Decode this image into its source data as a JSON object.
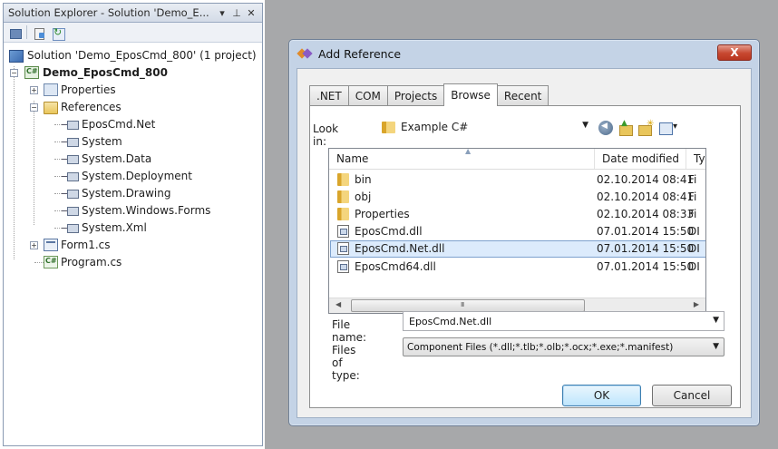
{
  "solution_explorer": {
    "title": "Solution Explorer - Solution 'Demo_E...",
    "pin_icon": "pin-icon",
    "dropdown_icon": "dropdown-icon",
    "close_icon": "close-icon",
    "tree": {
      "solution": "Solution 'Demo_EposCmd_800' (1 project)",
      "project": "Demo_EposCmd_800",
      "properties": "Properties",
      "references": "References",
      "reference_items": [
        "EposCmd.Net",
        "System",
        "System.Data",
        "System.Deployment",
        "System.Drawing",
        "System.Windows.Forms",
        "System.Xml"
      ],
      "form": "Form1.cs",
      "program": "Program.cs"
    }
  },
  "dialog": {
    "title": "Add Reference",
    "close_label": "X",
    "tabs": [
      ".NET",
      "COM",
      "Projects",
      "Browse",
      "Recent"
    ],
    "active_tab": "Browse",
    "look_in_label": "Look in:",
    "look_in_value": "Example C#",
    "columns": {
      "name": "Name",
      "date": "Date modified",
      "type": "Ty"
    },
    "files": [
      {
        "name": "bin",
        "date": "02.10.2014 08:41",
        "type": "Fi",
        "kind": "folder"
      },
      {
        "name": "obj",
        "date": "02.10.2014 08:41",
        "type": "Fi",
        "kind": "folder"
      },
      {
        "name": "Properties",
        "date": "02.10.2014 08:33",
        "type": "Fi",
        "kind": "folder"
      },
      {
        "name": "EposCmd.dll",
        "date": "07.01.2014 15:50",
        "type": "DI",
        "kind": "dll"
      },
      {
        "name": "EposCmd.Net.dll",
        "date": "07.01.2014 15:50",
        "type": "DI",
        "kind": "dll",
        "selected": true
      },
      {
        "name": "EposCmd64.dll",
        "date": "07.01.2014 15:50",
        "type": "DI",
        "kind": "dll"
      }
    ],
    "file_name_label": "File name:",
    "file_name_value": "EposCmd.Net.dll",
    "files_of_type_label": "Files of type:",
    "files_of_type_value": "Component Files (*.dll;*.tlb;*.olb;*.ocx;*.exe;*.manifest)",
    "ok_label": "OK",
    "cancel_label": "Cancel"
  },
  "colors": {
    "selection": "#dcebfc",
    "dialog_frame": "#c4d3e6",
    "background": "#a7a8aa",
    "close_button": "#c7472f"
  }
}
